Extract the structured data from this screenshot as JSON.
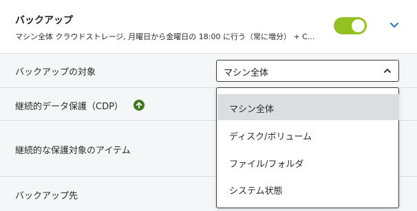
{
  "header": {
    "title": "バックアップ",
    "summary": "マシン全体 クラウドストレージ, 月曜日から金曜日の 18:00 に行う（常に増分） + C...",
    "toggle_on": true,
    "toggle_icon": "toggle-switch",
    "expand_icon": "chevron-down-icon"
  },
  "rows": {
    "backup_target_label": "バックアップの対象",
    "cdp_label": "継続的データ保護（CDP）",
    "cdp_icon": "upgrade-arrow-icon",
    "protected_items_label": "継続的な保護対象のアイテム",
    "destination_label": "バックアップ先"
  },
  "select": {
    "value": "マシン全体",
    "chevron_icon": "chevron-up-icon",
    "options": [
      {
        "label": "マシン全体",
        "selected": true
      },
      {
        "label": "ディスク/ボリューム",
        "selected": false
      },
      {
        "label": "ファイル/フォルダ",
        "selected": false
      },
      {
        "label": "システム状態",
        "selected": false
      }
    ]
  },
  "colors": {
    "toggle": "#93c11f",
    "chevron": "#2c6fb3",
    "cdp_icon": "#3d7a1e",
    "selected_option": "#dcdddf"
  }
}
